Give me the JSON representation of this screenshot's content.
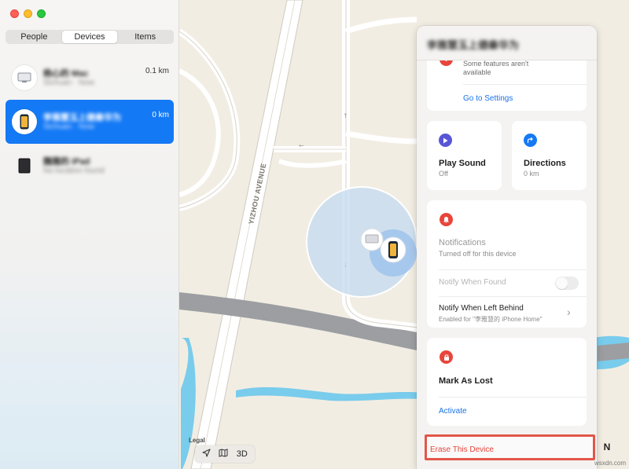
{
  "window": {
    "traffic_lights": [
      "close",
      "minimize",
      "zoom"
    ]
  },
  "sidebar": {
    "tabs": [
      {
        "label": "People",
        "active": false
      },
      {
        "label": "Devices",
        "active": true
      },
      {
        "label": "Items",
        "active": false
      }
    ],
    "devices": [
      {
        "name": "杨心的 Mac",
        "subtitle": "Sichuan · Now",
        "distance": "0.1 km",
        "icon": "mac-icon",
        "selected": false
      },
      {
        "name": "李雅慧玉上德秦华为",
        "subtitle": "Sichuan · Now",
        "distance": "0 km",
        "icon": "iphone-icon",
        "selected": true
      },
      {
        "name": "魏雅的 iPad",
        "subtitle": "No location found",
        "distance": "",
        "icon": "ipad-icon",
        "selected": false
      }
    ]
  },
  "map": {
    "road_label": "YIZHOU AVENUE",
    "legal_label": "Legal",
    "controls": {
      "location_icon": "location-arrow-icon",
      "map_icon": "map-icon",
      "view_3d_label": "3D"
    },
    "compass_label": "N",
    "colors": {
      "land": "#f2ede3",
      "water": "#6cc8ec",
      "accuracy_circle": "#c3d9f0"
    }
  },
  "panel": {
    "title": "李雅慧玉上德秦华为",
    "features_card": {
      "text": "Some features aren't available",
      "link": "Go to Settings"
    },
    "play_sound": {
      "title": "Play Sound",
      "status": "Off",
      "icon": "play-icon"
    },
    "directions": {
      "title": "Directions",
      "status": "0 km",
      "icon": "directions-icon"
    },
    "notifications": {
      "title": "Notifications",
      "subtitle": "Turned off for this device",
      "notify_found_label": "Notify When Found",
      "notify_left_label": "Notify When Left Behind",
      "notify_left_sub": "Enabled for \"李雅慧的 iPhone Home\"",
      "icon": "bell-icon"
    },
    "mark_as_lost": {
      "title": "Mark As Lost",
      "action": "Activate",
      "icon": "lock-icon"
    },
    "erase": {
      "label": "Erase This Device"
    }
  },
  "footer": {
    "watermark": "wsxdn.com"
  },
  "colors": {
    "accent": "#1479f5",
    "danger": "#e3564a",
    "link": "#1a73e8"
  }
}
